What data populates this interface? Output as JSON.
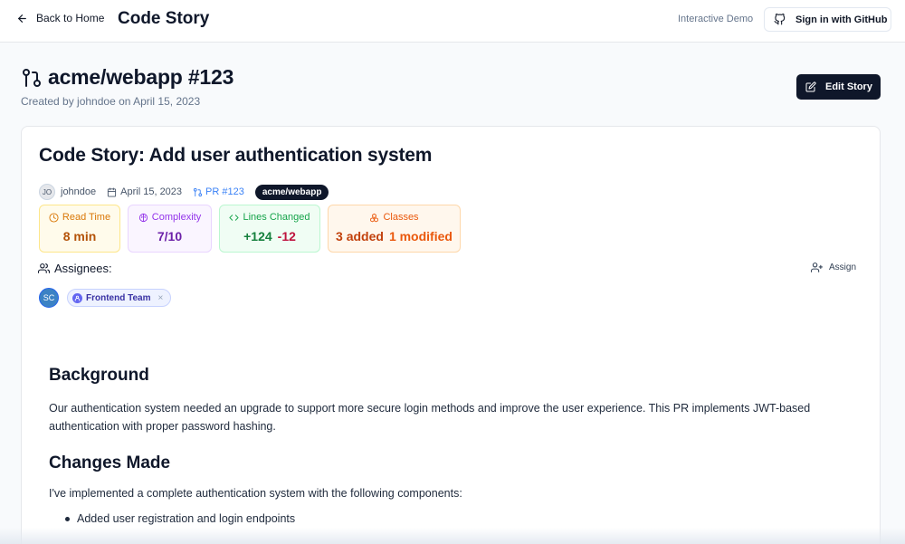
{
  "header": {
    "back_label": "Back to Home",
    "brand": "Code Story",
    "demo_label": "Interactive Demo",
    "signin_label": "Sign in with GitHub"
  },
  "repo": {
    "title": "acme/webapp #123",
    "created": "Created by johndoe on April 15, 2023",
    "edit_label": "Edit Story"
  },
  "story": {
    "title": "Code Story: Add user authentication system",
    "author_initials": "JO",
    "author": "johndoe",
    "date": "April 15, 2023",
    "pr": "PR #123",
    "repo_badge": "acme/webapp"
  },
  "stats": {
    "read_time": {
      "label": "Read Time",
      "value": "8 min"
    },
    "complexity": {
      "label": "Complexity",
      "value": "7/10"
    },
    "lines_changed": {
      "label": "Lines Changed",
      "added": "+124",
      "removed": "-12"
    },
    "classes": {
      "label": "Classes",
      "added": "3 added",
      "modified": "1 modified"
    }
  },
  "assignees": {
    "label": "Assignees:",
    "assign_label": "Assign",
    "person_initials": "SC",
    "team": "Frontend Team",
    "remove_glyph": "×"
  },
  "content": {
    "background_heading": "Background",
    "background_text": "Our authentication system needed an upgrade to support more secure login methods and improve the user experience. This PR implements JWT-based authentication with proper password hashing.",
    "changes_heading": "Changes Made",
    "changes_text": "I've implemented a complete authentication system with the following components:",
    "bullets": [
      "Added user registration and login endpoints"
    ]
  },
  "colors": {
    "primary_dark": "#0f172a",
    "link_blue": "#3b82f6"
  }
}
